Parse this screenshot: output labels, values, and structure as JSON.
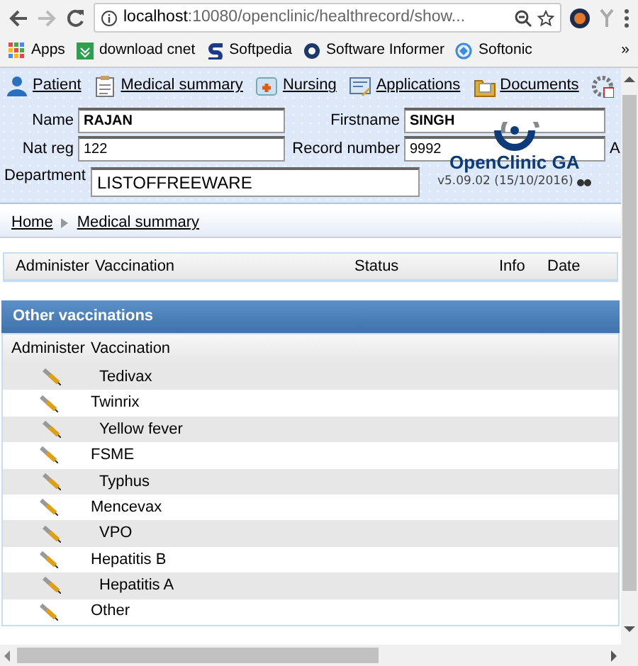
{
  "browser": {
    "url_host": "localhost",
    "url_rest": ":10080/openclinic/healthrecord/show...",
    "bookmarks": [
      {
        "label": "Apps"
      },
      {
        "label": "download cnet"
      },
      {
        "label": "Softpedia"
      },
      {
        "label": "Software Informer"
      },
      {
        "label": "Softonic"
      }
    ],
    "more": "»"
  },
  "menu": [
    {
      "label": "Patient"
    },
    {
      "label": "Medical summary"
    },
    {
      "label": "Nursing"
    },
    {
      "label": "Applications"
    },
    {
      "label": "Documents"
    }
  ],
  "patient": {
    "name_label": "Name",
    "name": "RAJAN",
    "firstname_label": "Firstname",
    "firstname": "SINGH",
    "natreg_label": "Nat reg",
    "natreg": "122",
    "record_label": "Record number",
    "record": "9992",
    "cut_label": "A",
    "department_label": "Department",
    "department": "LISTOFFREEWARE"
  },
  "logo": {
    "title": "OpenClinic GA",
    "version": "v5.09.02 (15/10/2016)"
  },
  "breadcrumb": [
    "Home",
    "Medical summary"
  ],
  "vaccinations_table": {
    "columns": [
      "Administer",
      "Vaccination",
      "Status",
      "Info",
      "Date"
    ]
  },
  "other": {
    "title": "Other vaccinations",
    "columns": [
      "Administer",
      "Vaccination"
    ],
    "rows": [
      {
        "name": "Tedivax",
        "shaded": true
      },
      {
        "name": "Twinrix",
        "shaded": false
      },
      {
        "name": "Yellow fever",
        "shaded": true
      },
      {
        "name": "FSME",
        "shaded": false
      },
      {
        "name": "Typhus",
        "shaded": true
      },
      {
        "name": "Mencevax",
        "shaded": false
      },
      {
        "name": "VPO",
        "shaded": true
      },
      {
        "name": "Hepatitis B",
        "shaded": false
      },
      {
        "name": "Hepatitis A",
        "shaded": true
      },
      {
        "name": "Other",
        "shaded": false
      }
    ]
  }
}
